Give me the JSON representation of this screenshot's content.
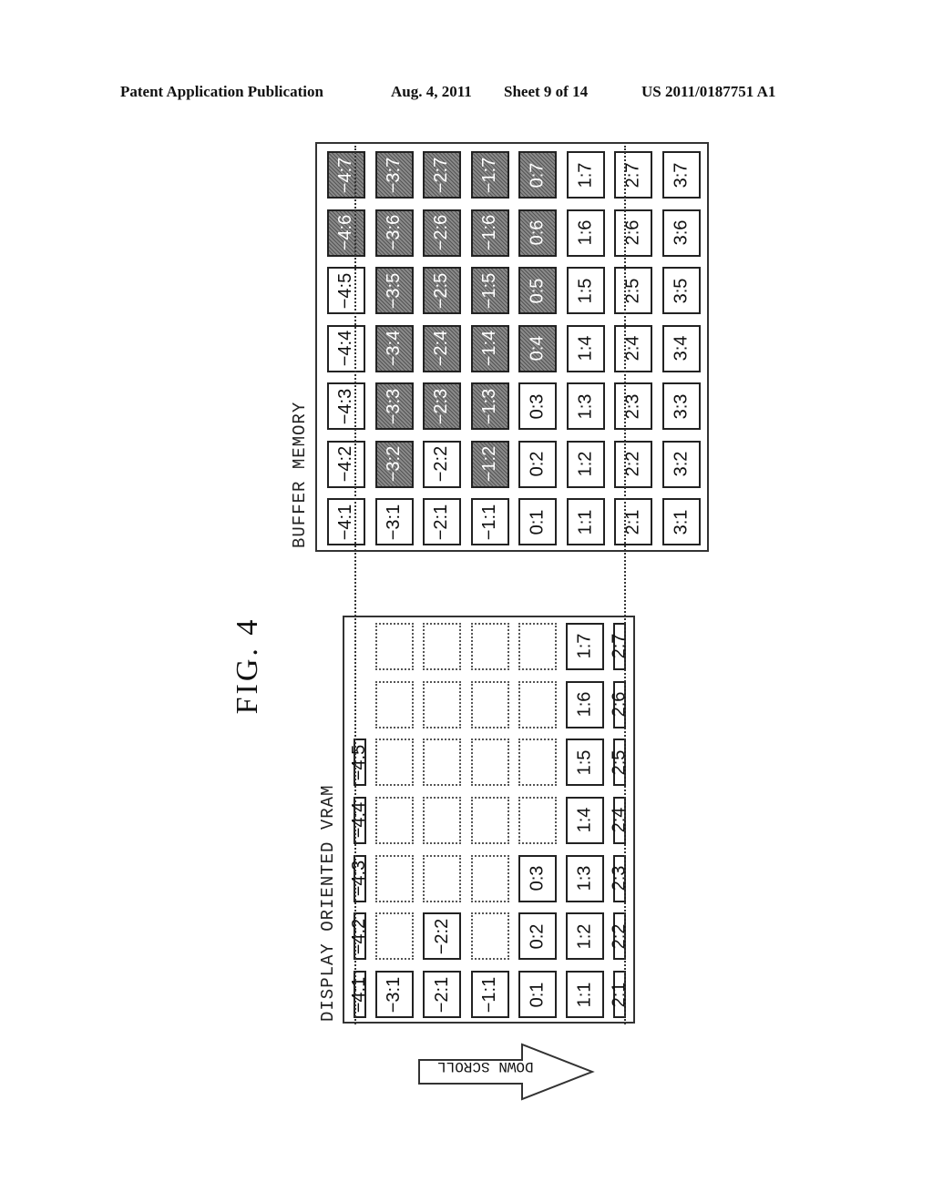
{
  "header": {
    "publication": "Patent Application Publication",
    "date": "Aug. 4, 2011",
    "sheet": "Sheet 9 of 14",
    "number": "US 2011/0187751 A1"
  },
  "figure": {
    "title": "FIG. 4",
    "buffer_label": "BUFFER MEMORY",
    "vram_label": "DISPLAY ORIENTED VRAM",
    "arrow_label": "DOWN SCROLL"
  },
  "buffer_memory": {
    "rows": [
      -4,
      -3,
      -2,
      -1,
      0,
      1,
      2,
      3
    ],
    "cols": [
      1,
      2,
      3,
      4,
      5,
      6,
      7
    ],
    "cells": [
      {
        "label": "-4:1",
        "shaded": false
      },
      {
        "label": "-4:2",
        "shaded": false
      },
      {
        "label": "-4:3",
        "shaded": false
      },
      {
        "label": "-4:4",
        "shaded": false
      },
      {
        "label": "-4:5",
        "shaded": false
      },
      {
        "label": "-4:6",
        "shaded": true
      },
      {
        "label": "-4:7",
        "shaded": true
      },
      {
        "label": "-3:1",
        "shaded": false
      },
      {
        "label": "-3:2",
        "shaded": true
      },
      {
        "label": "-3:3",
        "shaded": true
      },
      {
        "label": "-3:4",
        "shaded": true
      },
      {
        "label": "-3:5",
        "shaded": true
      },
      {
        "label": "-3:6",
        "shaded": true
      },
      {
        "label": "-3:7",
        "shaded": true
      },
      {
        "label": "-2:1",
        "shaded": false
      },
      {
        "label": "-2:2",
        "shaded": false
      },
      {
        "label": "-2:3",
        "shaded": true
      },
      {
        "label": "-2:4",
        "shaded": true
      },
      {
        "label": "-2:5",
        "shaded": true
      },
      {
        "label": "-2:6",
        "shaded": true
      },
      {
        "label": "-2:7",
        "shaded": true
      },
      {
        "label": "-1:1",
        "shaded": false
      },
      {
        "label": "-1:2",
        "shaded": true
      },
      {
        "label": "-1:3",
        "shaded": true
      },
      {
        "label": "-1:4",
        "shaded": true
      },
      {
        "label": "-1:5",
        "shaded": true
      },
      {
        "label": "-1:6",
        "shaded": true
      },
      {
        "label": "-1:7",
        "shaded": true
      },
      {
        "label": "0:1",
        "shaded": false
      },
      {
        "label": "0:2",
        "shaded": false
      },
      {
        "label": "0:3",
        "shaded": false
      },
      {
        "label": "0:4",
        "shaded": true
      },
      {
        "label": "0:5",
        "shaded": true
      },
      {
        "label": "0:6",
        "shaded": true
      },
      {
        "label": "0:7",
        "shaded": true
      },
      {
        "label": "1:1",
        "shaded": false
      },
      {
        "label": "1:2",
        "shaded": false
      },
      {
        "label": "1:3",
        "shaded": false
      },
      {
        "label": "1:4",
        "shaded": false
      },
      {
        "label": "1:5",
        "shaded": false
      },
      {
        "label": "1:6",
        "shaded": false
      },
      {
        "label": "1:7",
        "shaded": false
      },
      {
        "label": "2:1",
        "shaded": false
      },
      {
        "label": "2:2",
        "shaded": false
      },
      {
        "label": "2:3",
        "shaded": false
      },
      {
        "label": "2:4",
        "shaded": false
      },
      {
        "label": "2:5",
        "shaded": false
      },
      {
        "label": "2:6",
        "shaded": false
      },
      {
        "label": "2:7",
        "shaded": false
      },
      {
        "label": "3:1",
        "shaded": false
      },
      {
        "label": "3:2",
        "shaded": false
      },
      {
        "label": "3:3",
        "shaded": false
      },
      {
        "label": "3:4",
        "shaded": false
      },
      {
        "label": "3:5",
        "shaded": false
      },
      {
        "label": "3:6",
        "shaded": false
      },
      {
        "label": "3:7",
        "shaded": false
      }
    ]
  },
  "vram": {
    "top_partial": [
      "-4:1",
      "-4:2",
      "-4:3",
      "-4:4",
      "-4:5",
      "",
      ""
    ],
    "grid": [
      [
        "-3:1",
        "",
        "",
        "",
        "",
        "",
        ""
      ],
      [
        "-2:1",
        "-2:2",
        "",
        "",
        "",
        "",
        ""
      ],
      [
        "-1:1",
        "",
        "",
        "",
        "",
        "",
        ""
      ],
      [
        "0:1",
        "0:2",
        "0:3",
        "",
        "",
        "",
        ""
      ],
      [
        "1:1",
        "1:2",
        "1:3",
        "1:4",
        "1:5",
        "1:6",
        "1:7"
      ]
    ],
    "bottom_partial": [
      "2:1",
      "2:2",
      "2:3",
      "2:4",
      "2:5",
      "2:6",
      "2:7"
    ]
  }
}
